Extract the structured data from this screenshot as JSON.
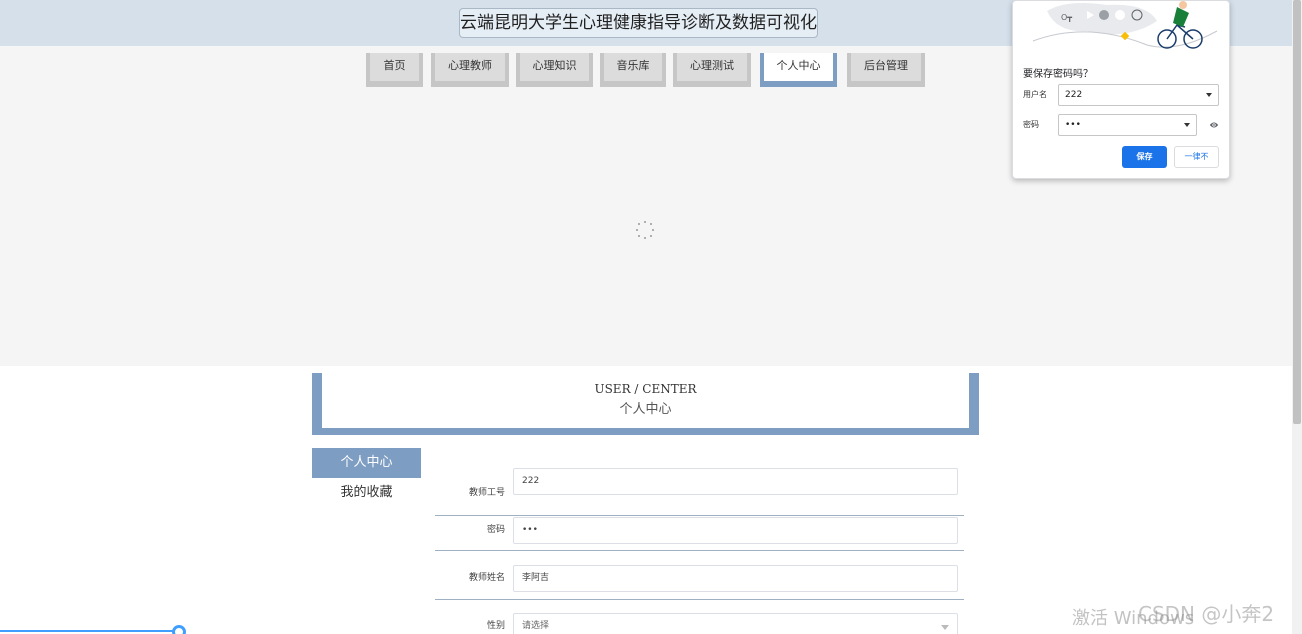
{
  "header": {
    "title": "云端昆明大学生心理健康指导诊断及数据可视化"
  },
  "nav": {
    "items": [
      {
        "label": "首页"
      },
      {
        "label": "心理教师"
      },
      {
        "label": "心理知识"
      },
      {
        "label": "音乐库"
      },
      {
        "label": "心理测试"
      },
      {
        "label": "个人中心"
      },
      {
        "label": "后台管理"
      }
    ],
    "active": "个人中心"
  },
  "center": {
    "title_en": "USER / CENTER",
    "title_zh": "个人中心"
  },
  "side_menu": {
    "items": [
      {
        "label": "个人中心"
      },
      {
        "label": "我的收藏"
      }
    ],
    "active": "个人中心"
  },
  "form": {
    "fields": [
      {
        "label": "教师工号",
        "value": "222"
      },
      {
        "label": "密码",
        "value": "•••"
      },
      {
        "label": "教师姓名",
        "value": "李阿吉"
      },
      {
        "label": "性别",
        "value": "请选择"
      }
    ]
  },
  "password_popup": {
    "title": "要保存密码吗？",
    "username_label": "用户名",
    "username_value": "222",
    "password_label": "密码",
    "password_value": "•••",
    "save_label": "保存",
    "never_label": "一律不"
  },
  "watermarks": {
    "windows": "激活 Windows",
    "csdn": "CSDN @小奔2"
  },
  "colors": {
    "accent": "#7e9dc2",
    "header_bg": "#d5e0eb",
    "primary_button": "#1a73e8"
  }
}
